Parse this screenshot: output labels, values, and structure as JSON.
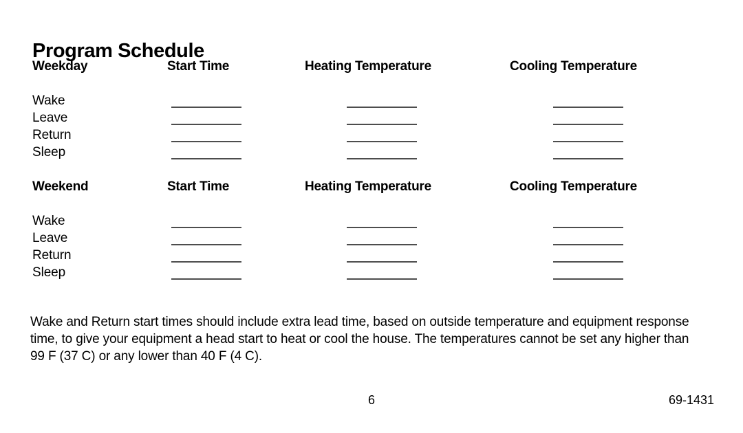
{
  "document": {
    "title": "Program Schedule"
  },
  "schedules": [
    {
      "id": "weekday",
      "headers": {
        "group": "Weekday",
        "start_time": "Start Time",
        "heating_temperature": "Heating Temperature",
        "cooling_temperature": "Cooling Temperature"
      },
      "rows": [
        {
          "label": "Wake",
          "start_time": "",
          "heating_temperature": "",
          "cooling_temperature": ""
        },
        {
          "label": "Leave",
          "start_time": "",
          "heating_temperature": "",
          "cooling_temperature": ""
        },
        {
          "label": "Return",
          "start_time": "",
          "heating_temperature": "",
          "cooling_temperature": ""
        },
        {
          "label": "Sleep",
          "start_time": "",
          "heating_temperature": "",
          "cooling_temperature": ""
        }
      ]
    },
    {
      "id": "weekend",
      "headers": {
        "group": "Weekend",
        "start_time": "Start Time",
        "heating_temperature": "Heating Temperature",
        "cooling_temperature": "Cooling Temperature"
      },
      "rows": [
        {
          "label": "Wake",
          "start_time": "",
          "heating_temperature": "",
          "cooling_temperature": ""
        },
        {
          "label": "Leave",
          "start_time": "",
          "heating_temperature": "",
          "cooling_temperature": ""
        },
        {
          "label": "Return",
          "start_time": "",
          "heating_temperature": "",
          "cooling_temperature": ""
        },
        {
          "label": "Sleep",
          "start_time": "",
          "heating_temperature": "",
          "cooling_temperature": ""
        }
      ]
    }
  ],
  "note": {
    "text": "Wake and Return start times should include extra lead time, based on outside temperature and equipment response time, to give your equipment a head start to heat or cool the house. The temperatures cannot be set any higher than 99 F (37 C) or any lower than 40 F (4 C)."
  },
  "footer": {
    "page_number": "6",
    "document_code": "69-1431"
  },
  "colors": {
    "text": "#000000",
    "rule": "#4d4d4d",
    "background": "#ffffff"
  }
}
